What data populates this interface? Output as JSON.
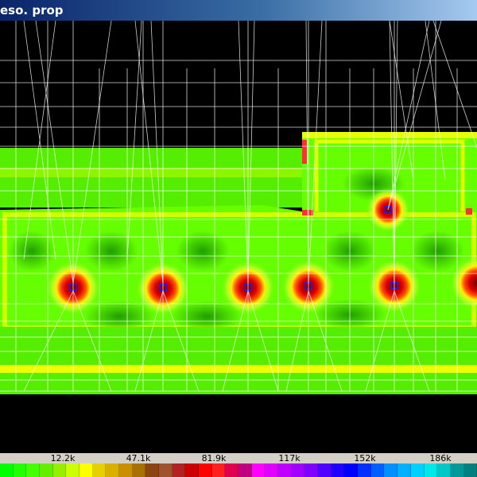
{
  "window": {
    "title": "eso. prop"
  },
  "plot": {
    "mode": "contour-map"
  },
  "legend": {
    "ticks": [
      "12.2k",
      "47.1k",
      "81.9k",
      "117k",
      "152k",
      "186k"
    ],
    "colors": [
      "#00ff00",
      "#22ff00",
      "#44ff00",
      "#66ee00",
      "#99ee00",
      "#ccff00",
      "#ffff00",
      "#e8d000",
      "#d8b000",
      "#c89000",
      "#a87000",
      "#8b4513",
      "#a0522d",
      "#b22222",
      "#cc0000",
      "#ff0000",
      "#ff2020",
      "#e00050",
      "#c00080",
      "#ff00ff",
      "#e000ff",
      "#c000ff",
      "#a000ff",
      "#8000ff",
      "#5000ff",
      "#2000ff",
      "#0000ff",
      "#0030ff",
      "#0060ff",
      "#0090ff",
      "#00b0ff",
      "#00d0ff",
      "#00e8e8",
      "#00c8c8",
      "#009999",
      "#008080"
    ],
    "colors_meaning": "stress-scale"
  },
  "colors": {
    "background": "#000000",
    "mesh": "#ffffff",
    "field": "#66ff00",
    "hotspot": "#dd0000"
  }
}
